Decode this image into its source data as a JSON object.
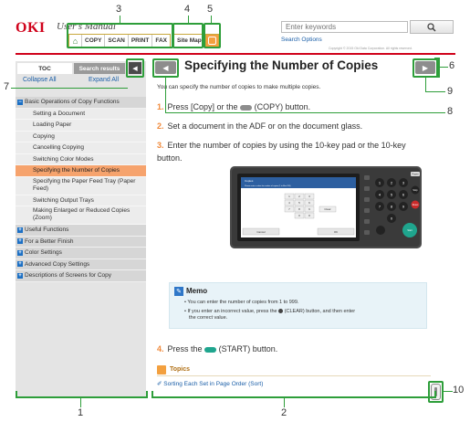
{
  "header": {
    "logo": "OKI",
    "manual_title": "User's Manual",
    "nav_items": [
      "COPY",
      "SCAN",
      "PRINT",
      "FAX"
    ],
    "sitemap_label": "Site Map",
    "search_placeholder": "Enter keywords",
    "search_options": "Search Options",
    "copyright": "Copyright © 2015 Oki Data Corporation. All rights reserved.",
    "search_icon": "search-icon",
    "home_icon": "home-icon",
    "sound_icon": "speaker-icon",
    "accent_color": "#d0021b"
  },
  "callouts": [
    "1",
    "2",
    "3",
    "4",
    "5",
    "6",
    "7",
    "8",
    "9",
    "10"
  ],
  "sidebar": {
    "tab_toc": "TOC",
    "tab_search": "Search results",
    "collapse_all": "Collapse All",
    "expand_all": "Expand All",
    "items": [
      {
        "label": "Basic Operations of Copy Functions",
        "type": "parent",
        "toggle": "−"
      },
      {
        "label": "Setting a Document",
        "type": "child"
      },
      {
        "label": "Loading Paper",
        "type": "child"
      },
      {
        "label": "Copying",
        "type": "child"
      },
      {
        "label": "Cancelling Copying",
        "type": "child"
      },
      {
        "label": "Switching Color Modes",
        "type": "child"
      },
      {
        "label": "Specifying the Number of Copies",
        "type": "child",
        "active": true
      },
      {
        "label": "Specifying the Paper Feed Tray (Paper Feed)",
        "type": "child"
      },
      {
        "label": "Switching Output Trays",
        "type": "child"
      },
      {
        "label": "Making Enlarged or Reduced Copies (Zoom)",
        "type": "child"
      },
      {
        "label": "Useful Functions",
        "type": "parent",
        "toggle": "+"
      },
      {
        "label": "For a Better Finish",
        "type": "parent",
        "toggle": "+"
      },
      {
        "label": "Color Settings",
        "type": "parent",
        "toggle": "+"
      },
      {
        "label": "Advanced Copy Settings",
        "type": "parent",
        "toggle": "+"
      },
      {
        "label": "Descriptions of Screens for Copy",
        "type": "parent",
        "toggle": "+"
      }
    ]
  },
  "main": {
    "title": "Specifying the Number of Copies",
    "intro": "You can specify the number of copies to make multiple copies.",
    "steps": [
      {
        "num": "1.",
        "pre": "Press [Copy] or the",
        "post": "(COPY) button."
      },
      {
        "num": "2.",
        "text": "Set a document in the ADF or on the document glass."
      },
      {
        "num": "3.",
        "text": "Enter the number of copies by using the 10-key pad or the 10-key button."
      },
      {
        "num": "4.",
        "pre": "Press the",
        "post": "(START) button."
      }
    ],
    "panel": {
      "header_line": "Copies",
      "sub_line": "Please enter a value for number of copies (1 to Max 999)",
      "keys": [
        "1",
        "2",
        "3",
        "4",
        "5",
        "6",
        "7",
        "8",
        "9",
        "0",
        "#"
      ],
      "clear_key": "Clear",
      "cancel": "Cancel",
      "ok": "OK",
      "hw_keys": [
        "1",
        "2",
        "3",
        "4",
        "5",
        "6",
        "7",
        "8",
        "9",
        "0"
      ],
      "hw_labels": [
        "Power",
        "Stop",
        "Reset",
        "Start"
      ]
    },
    "memo": {
      "title": "Memo",
      "items": [
        "You can enter the number of copies from 1 to 999.",
        "If you enter an incorrect value, press the",
        "(CLEAR) button, and then enter",
        "the correct value."
      ]
    },
    "topics": {
      "label": "Topics",
      "link": "Sorting Each Set in Page Order (Sort)"
    }
  }
}
